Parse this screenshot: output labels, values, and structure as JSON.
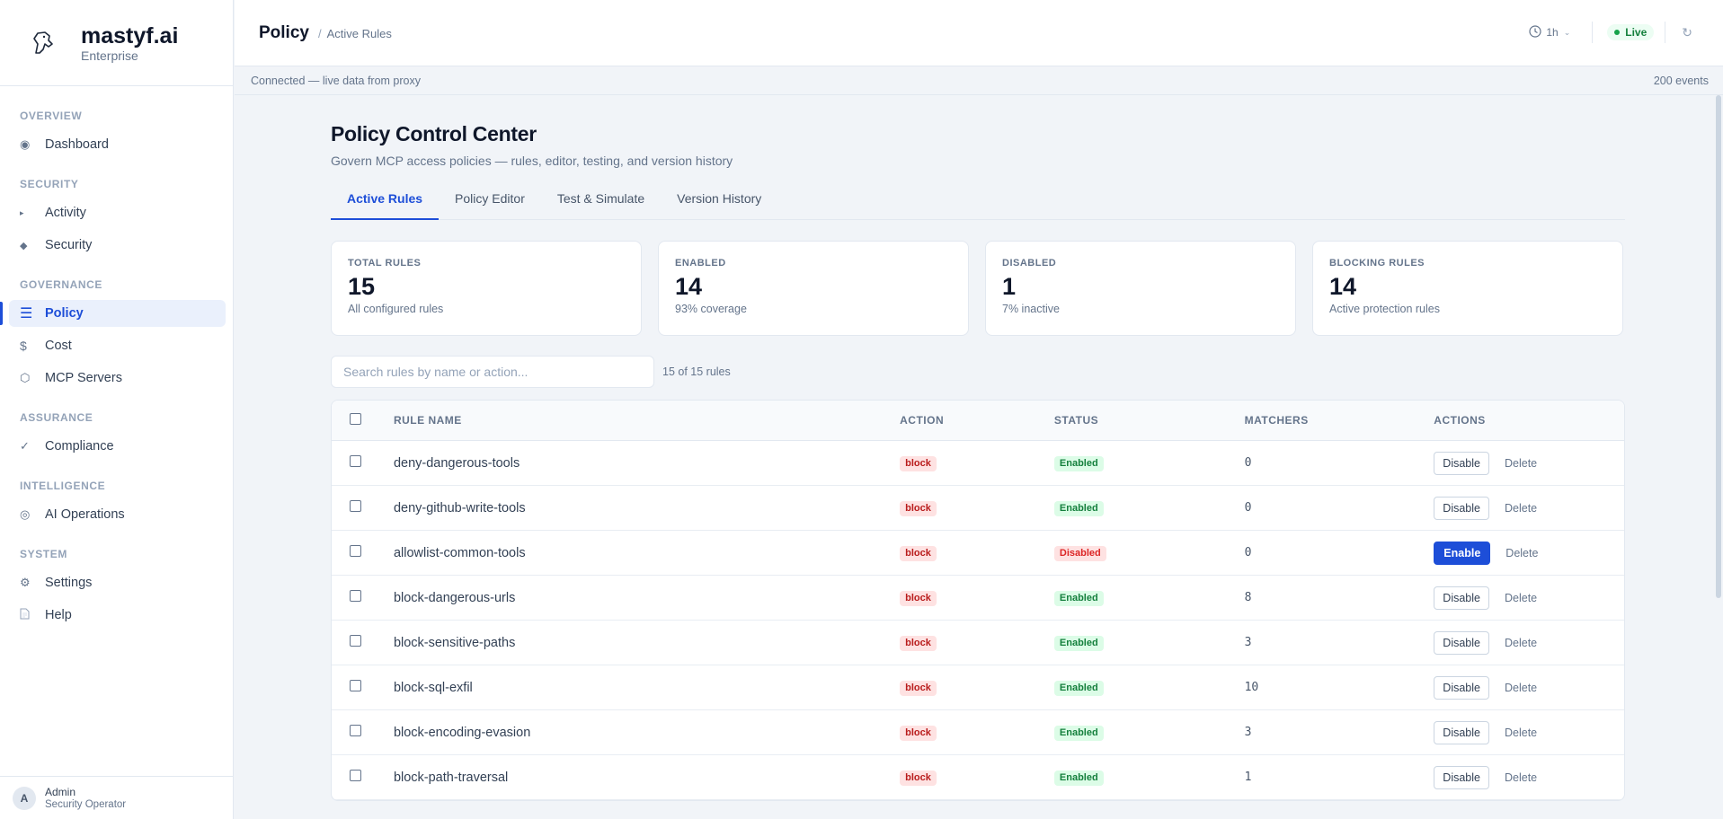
{
  "brand": {
    "name": "mastyf.ai",
    "tier": "Enterprise"
  },
  "sidebar": {
    "sections": [
      {
        "header": "OVERVIEW",
        "items": [
          {
            "label": "Dashboard",
            "icon": "dashboard-icon"
          }
        ]
      },
      {
        "header": "SECURITY",
        "items": [
          {
            "label": "Activity",
            "icon": "activity-icon"
          },
          {
            "label": "Security",
            "icon": "security-icon"
          }
        ]
      },
      {
        "header": "GOVERNANCE",
        "items": [
          {
            "label": "Policy",
            "icon": "policy-icon",
            "active": true
          },
          {
            "label": "Cost",
            "icon": "dollar-icon"
          },
          {
            "label": "MCP Servers",
            "icon": "servers-icon"
          }
        ]
      },
      {
        "header": "ASSURANCE",
        "items": [
          {
            "label": "Compliance",
            "icon": "check-icon"
          }
        ]
      },
      {
        "header": "INTELLIGENCE",
        "items": [
          {
            "label": "AI Operations",
            "icon": "ai-ops-icon"
          }
        ]
      },
      {
        "header": "SYSTEM",
        "items": [
          {
            "label": "Settings",
            "icon": "gear-icon"
          },
          {
            "label": "Help",
            "icon": "doc-icon"
          }
        ]
      }
    ],
    "user": {
      "initial": "A",
      "name": "Admin",
      "role": "Security Operator"
    }
  },
  "topbar": {
    "title": "Policy",
    "separator": "/",
    "current": "Active Rules",
    "time_range": "1h",
    "live_label": "Live"
  },
  "status": {
    "left": "Connected — live data from proxy",
    "right": "200 events"
  },
  "page": {
    "title": "Policy Control Center",
    "subtitle": "Govern MCP access policies — rules, editor, testing, and version history",
    "tabs": [
      "Active Rules",
      "Policy Editor",
      "Test & Simulate",
      "Version History"
    ],
    "active_tab": 0
  },
  "stats": [
    {
      "label": "TOTAL RULES",
      "value": "15",
      "desc": "All configured rules"
    },
    {
      "label": "ENABLED",
      "value": "14",
      "desc": "93% coverage"
    },
    {
      "label": "DISABLED",
      "value": "1",
      "desc": "7% inactive"
    },
    {
      "label": "BLOCKING RULES",
      "value": "14",
      "desc": "Active protection rules"
    }
  ],
  "search": {
    "placeholder": "Search rules by name or action...",
    "value": "",
    "count": "15 of 15 rules"
  },
  "table": {
    "headers": {
      "name": "RULE NAME",
      "action": "ACTION",
      "status": "STATUS",
      "matchers": "MATCHERS",
      "actions": "ACTIONS"
    },
    "delete_label": "Delete",
    "rows": [
      {
        "name": "deny-dangerous-tools",
        "action": "block",
        "status": "Enabled",
        "matchers": "0",
        "button": "Disable",
        "enabled": true
      },
      {
        "name": "deny-github-write-tools",
        "action": "block",
        "status": "Enabled",
        "matchers": "0",
        "button": "Disable",
        "enabled": true
      },
      {
        "name": "allowlist-common-tools",
        "action": "block",
        "status": "Disabled",
        "matchers": "0",
        "button": "Enable",
        "enabled": false
      },
      {
        "name": "block-dangerous-urls",
        "action": "block",
        "status": "Enabled",
        "matchers": "8",
        "button": "Disable",
        "enabled": true
      },
      {
        "name": "block-sensitive-paths",
        "action": "block",
        "status": "Enabled",
        "matchers": "3",
        "button": "Disable",
        "enabled": true
      },
      {
        "name": "block-sql-exfil",
        "action": "block",
        "status": "Enabled",
        "matchers": "10",
        "button": "Disable",
        "enabled": true
      },
      {
        "name": "block-encoding-evasion",
        "action": "block",
        "status": "Enabled",
        "matchers": "3",
        "button": "Disable",
        "enabled": true
      },
      {
        "name": "block-path-traversal",
        "action": "block",
        "status": "Enabled",
        "matchers": "1",
        "button": "Disable",
        "enabled": true
      }
    ]
  },
  "colors": {
    "accent": "#1d4ed8",
    "enabled": "#15803d",
    "danger": "#b91c1c",
    "sidebar_bg": "#ffffff",
    "page_bg": "#f1f4f8"
  }
}
